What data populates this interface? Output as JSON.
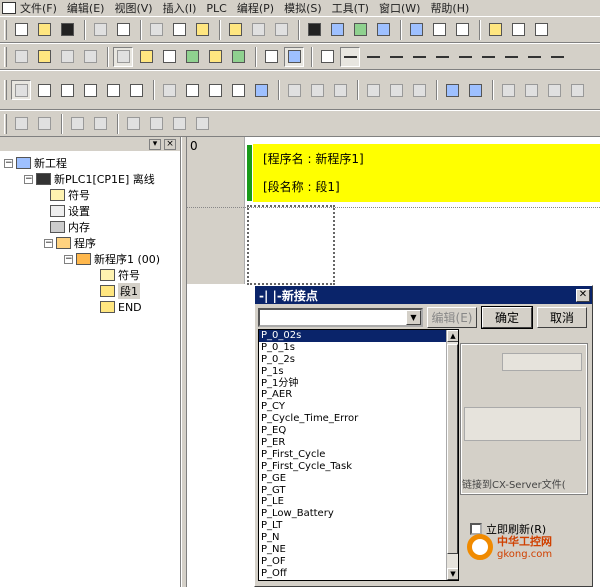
{
  "menubar": [
    "文件(F)",
    "编辑(E)",
    "视图(V)",
    "插入(I)",
    "PLC",
    "编程(P)",
    "模拟(S)",
    "工具(T)",
    "窗口(W)",
    "帮助(H)"
  ],
  "tree": {
    "root": "新工程",
    "plc": "新PLC1[CP1E] 离线",
    "symbols": "符号",
    "settings": "设置",
    "memory": "内存",
    "programs": "程序",
    "program1": "新程序1 (00)",
    "prog_symbols": "符号",
    "section1": "段1",
    "end": "END"
  },
  "ladder": {
    "rung_number": "0",
    "program_name": "[程序名 : 新程序1]",
    "section_name": "[段名称 : 段1]"
  },
  "dialog": {
    "title": "-| |-新接点",
    "combo_value": "",
    "edit_label": "编辑(E)",
    "ok_label": "确定",
    "cancel_label": "取消",
    "link_text": "链接到CX-Server文件(",
    "refresh_label": "立即刷新(R)",
    "options": [
      "P_0_02s",
      "P_0_1s",
      "P_0_2s",
      "P_1s",
      "P_1分钟",
      "P_AER",
      "P_CY",
      "P_Cycle_Time_Error",
      "P_EQ",
      "P_ER",
      "P_First_Cycle",
      "P_First_Cycle_Task",
      "P_GE",
      "P_GT",
      "P_LE",
      "P_Low_Battery",
      "P_LT",
      "P_N",
      "P_NE",
      "P_OF",
      "P_Off"
    ],
    "selected_index": 0
  },
  "watermark": {
    "line1": "中华工控网",
    "line2": "gkong.com"
  },
  "colors": {
    "title_bar": "#0a246a",
    "annotation_bg": "#ffff00",
    "rung_bar": "#1a9a1a"
  }
}
